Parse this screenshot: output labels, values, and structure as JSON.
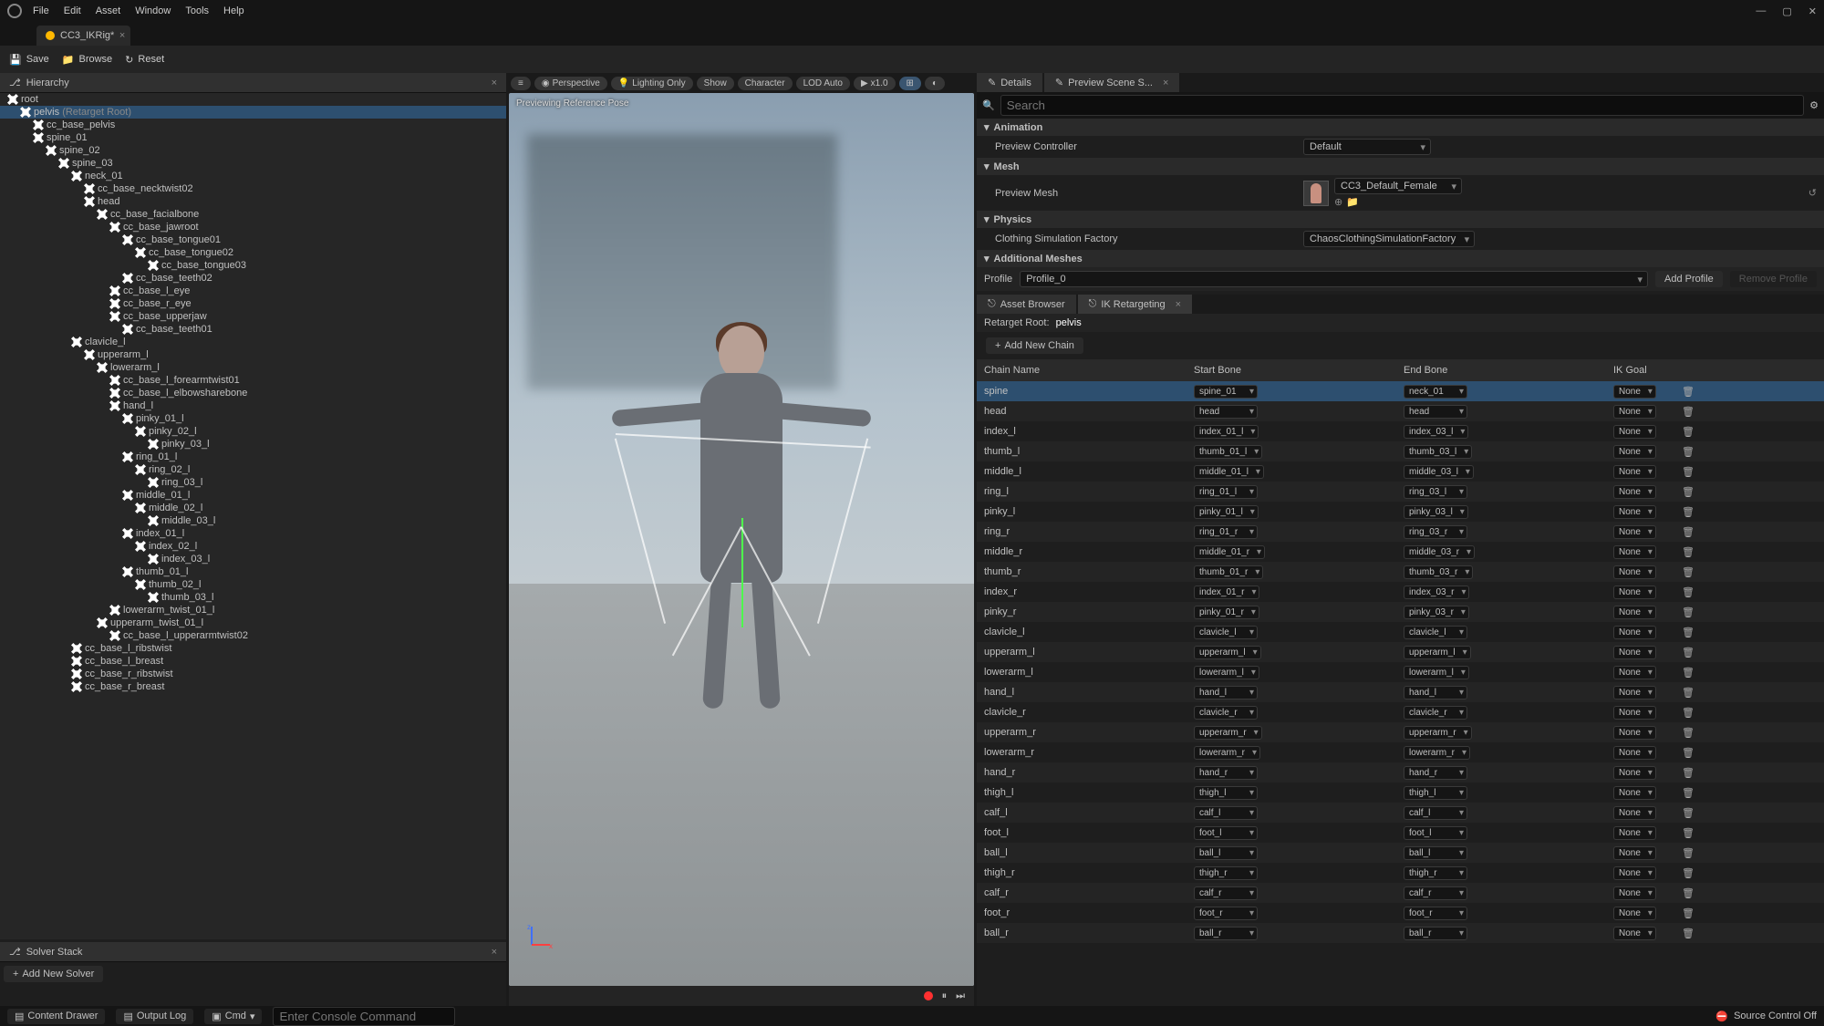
{
  "menu": [
    "File",
    "Edit",
    "Asset",
    "Window",
    "Tools",
    "Help"
  ],
  "asset_tab": "CC3_IKRig*",
  "toolbar": {
    "save": "Save",
    "browse": "Browse",
    "reset": "Reset"
  },
  "hierarchy": {
    "title": "Hierarchy",
    "retarget_suffix": "(Retarget Root)",
    "nodes": [
      {
        "d": 0,
        "n": "root"
      },
      {
        "d": 1,
        "n": "pelvis",
        "suffix": true,
        "sel": true
      },
      {
        "d": 2,
        "n": "cc_base_pelvis"
      },
      {
        "d": 2,
        "n": "spine_01"
      },
      {
        "d": 3,
        "n": "spine_02"
      },
      {
        "d": 4,
        "n": "spine_03"
      },
      {
        "d": 5,
        "n": "neck_01"
      },
      {
        "d": 6,
        "n": "cc_base_necktwist02"
      },
      {
        "d": 6,
        "n": "head"
      },
      {
        "d": 7,
        "n": "cc_base_facialbone"
      },
      {
        "d": 8,
        "n": "cc_base_jawroot"
      },
      {
        "d": 9,
        "n": "cc_base_tongue01"
      },
      {
        "d": 10,
        "n": "cc_base_tongue02"
      },
      {
        "d": 11,
        "n": "cc_base_tongue03"
      },
      {
        "d": 9,
        "n": "cc_base_teeth02"
      },
      {
        "d": 8,
        "n": "cc_base_l_eye"
      },
      {
        "d": 8,
        "n": "cc_base_r_eye"
      },
      {
        "d": 8,
        "n": "cc_base_upperjaw"
      },
      {
        "d": 9,
        "n": "cc_base_teeth01"
      },
      {
        "d": 5,
        "n": "clavicle_l"
      },
      {
        "d": 6,
        "n": "upperarm_l"
      },
      {
        "d": 7,
        "n": "lowerarm_l"
      },
      {
        "d": 8,
        "n": "cc_base_l_forearmtwist01"
      },
      {
        "d": 8,
        "n": "cc_base_l_elbowsharebone"
      },
      {
        "d": 8,
        "n": "hand_l"
      },
      {
        "d": 9,
        "n": "pinky_01_l"
      },
      {
        "d": 10,
        "n": "pinky_02_l"
      },
      {
        "d": 11,
        "n": "pinky_03_l"
      },
      {
        "d": 9,
        "n": "ring_01_l"
      },
      {
        "d": 10,
        "n": "ring_02_l"
      },
      {
        "d": 11,
        "n": "ring_03_l"
      },
      {
        "d": 9,
        "n": "middle_01_l"
      },
      {
        "d": 10,
        "n": "middle_02_l"
      },
      {
        "d": 11,
        "n": "middle_03_l"
      },
      {
        "d": 9,
        "n": "index_01_l"
      },
      {
        "d": 10,
        "n": "index_02_l"
      },
      {
        "d": 11,
        "n": "index_03_l"
      },
      {
        "d": 9,
        "n": "thumb_01_l"
      },
      {
        "d": 10,
        "n": "thumb_02_l"
      },
      {
        "d": 11,
        "n": "thumb_03_l"
      },
      {
        "d": 8,
        "n": "lowerarm_twist_01_l"
      },
      {
        "d": 7,
        "n": "upperarm_twist_01_l"
      },
      {
        "d": 8,
        "n": "cc_base_l_upperarmtwist02"
      },
      {
        "d": 5,
        "n": "cc_base_l_ribstwist"
      },
      {
        "d": 5,
        "n": "cc_base_l_breast"
      },
      {
        "d": 5,
        "n": "cc_base_r_ribstwist"
      },
      {
        "d": 5,
        "n": "cc_base_r_breast"
      }
    ]
  },
  "solver": {
    "title": "Solver Stack",
    "add": "Add New Solver"
  },
  "viewport": {
    "overlay": "Previewing Reference Pose",
    "pills": [
      "Perspective",
      "Lighting Only",
      "Show",
      "Character",
      "LOD Auto"
    ],
    "speed": "x1.0"
  },
  "details": {
    "tab1": "Details",
    "tab2": "Preview Scene S...",
    "search_ph": "Search",
    "sections": {
      "animation": "Animation",
      "preview_controller": "Preview Controller",
      "preview_controller_val": "Default",
      "mesh": "Mesh",
      "preview_mesh": "Preview Mesh",
      "preview_mesh_val": "CC3_Default_Female",
      "physics": "Physics",
      "clothing": "Clothing Simulation Factory",
      "clothing_val": "ChaosClothingSimulationFactory",
      "additional": "Additional Meshes"
    },
    "profile": "Profile",
    "profile_val": "Profile_0",
    "add_profile": "Add Profile",
    "remove_profile": "Remove Profile"
  },
  "browser": {
    "tab1": "Asset Browser",
    "tab2": "IK Retargeting",
    "retarget_root_lbl": "Retarget Root:",
    "retarget_root_val": "pelvis",
    "add_chain": "Add New Chain",
    "headers": {
      "name": "Chain Name",
      "start": "Start Bone",
      "end": "End Bone",
      "goal": "IK Goal"
    }
  },
  "chart_data": {
    "type": "table",
    "columns": [
      "Chain Name",
      "Start Bone",
      "End Bone",
      "IK Goal"
    ],
    "rows": [
      {
        "name": "spine",
        "start": "spine_01",
        "end": "neck_01",
        "goal": "None",
        "sel": true
      },
      {
        "name": "head",
        "start": "head",
        "end": "head",
        "goal": "None"
      },
      {
        "name": "index_l",
        "start": "index_01_l",
        "end": "index_03_l",
        "goal": "None"
      },
      {
        "name": "thumb_l",
        "start": "thumb_01_l",
        "end": "thumb_03_l",
        "goal": "None"
      },
      {
        "name": "middle_l",
        "start": "middle_01_l",
        "end": "middle_03_l",
        "goal": "None"
      },
      {
        "name": "ring_l",
        "start": "ring_01_l",
        "end": "ring_03_l",
        "goal": "None"
      },
      {
        "name": "pinky_l",
        "start": "pinky_01_l",
        "end": "pinky_03_l",
        "goal": "None"
      },
      {
        "name": "ring_r",
        "start": "ring_01_r",
        "end": "ring_03_r",
        "goal": "None"
      },
      {
        "name": "middle_r",
        "start": "middle_01_r",
        "end": "middle_03_r",
        "goal": "None"
      },
      {
        "name": "thumb_r",
        "start": "thumb_01_r",
        "end": "thumb_03_r",
        "goal": "None"
      },
      {
        "name": "index_r",
        "start": "index_01_r",
        "end": "index_03_r",
        "goal": "None"
      },
      {
        "name": "pinky_r",
        "start": "pinky_01_r",
        "end": "pinky_03_r",
        "goal": "None"
      },
      {
        "name": "clavicle_l",
        "start": "clavicle_l",
        "end": "clavicle_l",
        "goal": "None"
      },
      {
        "name": "upperarm_l",
        "start": "upperarm_l",
        "end": "upperarm_l",
        "goal": "None"
      },
      {
        "name": "lowerarm_l",
        "start": "lowerarm_l",
        "end": "lowerarm_l",
        "goal": "None"
      },
      {
        "name": "hand_l",
        "start": "hand_l",
        "end": "hand_l",
        "goal": "None"
      },
      {
        "name": "clavicle_r",
        "start": "clavicle_r",
        "end": "clavicle_r",
        "goal": "None"
      },
      {
        "name": "upperarm_r",
        "start": "upperarm_r",
        "end": "upperarm_r",
        "goal": "None"
      },
      {
        "name": "lowerarm_r",
        "start": "lowerarm_r",
        "end": "lowerarm_r",
        "goal": "None"
      },
      {
        "name": "hand_r",
        "start": "hand_r",
        "end": "hand_r",
        "goal": "None"
      },
      {
        "name": "thigh_l",
        "start": "thigh_l",
        "end": "thigh_l",
        "goal": "None"
      },
      {
        "name": "calf_l",
        "start": "calf_l",
        "end": "calf_l",
        "goal": "None"
      },
      {
        "name": "foot_l",
        "start": "foot_l",
        "end": "foot_l",
        "goal": "None"
      },
      {
        "name": "ball_l",
        "start": "ball_l",
        "end": "ball_l",
        "goal": "None"
      },
      {
        "name": "thigh_r",
        "start": "thigh_r",
        "end": "thigh_r",
        "goal": "None"
      },
      {
        "name": "calf_r",
        "start": "calf_r",
        "end": "calf_r",
        "goal": "None"
      },
      {
        "name": "foot_r",
        "start": "foot_r",
        "end": "foot_r",
        "goal": "None"
      },
      {
        "name": "ball_r",
        "start": "ball_r",
        "end": "ball_r",
        "goal": "None"
      }
    ]
  },
  "status": {
    "content_drawer": "Content Drawer",
    "output_log": "Output Log",
    "cmd": "Cmd",
    "console_ph": "Enter Console Command",
    "source_control": "Source Control Off"
  }
}
